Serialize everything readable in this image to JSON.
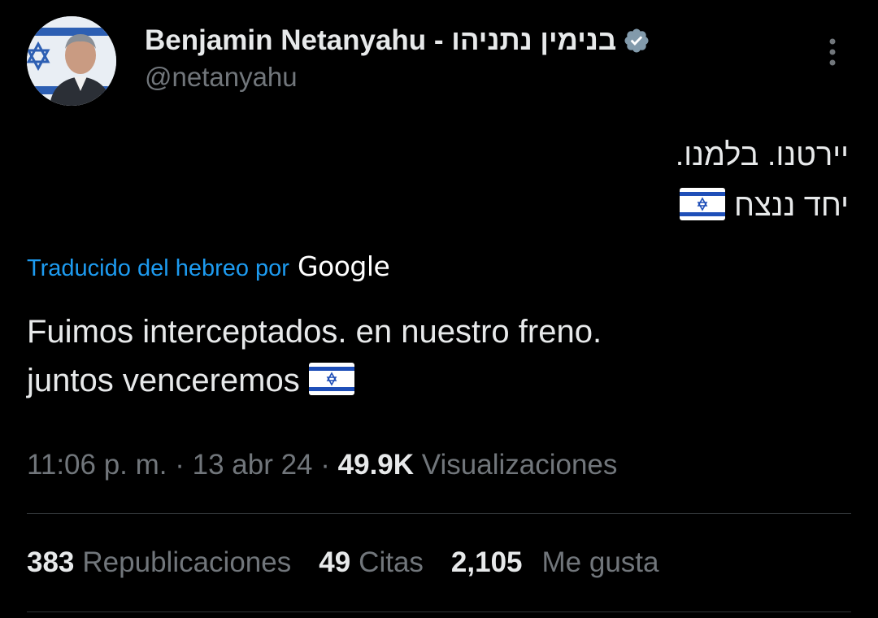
{
  "author": {
    "display_name": "Benjamin Netanyahu - בנימין נתניהו",
    "handle": "@netanyahu",
    "verified_icon": "verified-badge-icon"
  },
  "tweet": {
    "hebrew_lines": [
      "יירטנו. בלמנו.",
      "יחד ננצח"
    ],
    "flag_icon": "israel-flag-emoji",
    "translated_label": "Traducido del hebreo por",
    "translator": "Google",
    "translation_lines": [
      "Fuimos interceptados. en nuestro freno.",
      "juntos venceremos"
    ]
  },
  "meta": {
    "time": "11:06 p. m.",
    "sep1": " · ",
    "date": "13 abr 24",
    "sep2": " · ",
    "views_count": "49.9K",
    "views_label": "Visualizaciones"
  },
  "stats": {
    "reposts_count": "383",
    "reposts_label": "Republicaciones",
    "quotes_count": "49",
    "quotes_label": "Citas",
    "likes_count": "2,105",
    "likes_label": "Me gusta"
  },
  "colors": {
    "background": "#000000",
    "primary_text": "#e7e9ea",
    "secondary_text": "#71767b",
    "link": "#1d9bf0",
    "divider": "#2f3336",
    "verified": "#829aab"
  }
}
